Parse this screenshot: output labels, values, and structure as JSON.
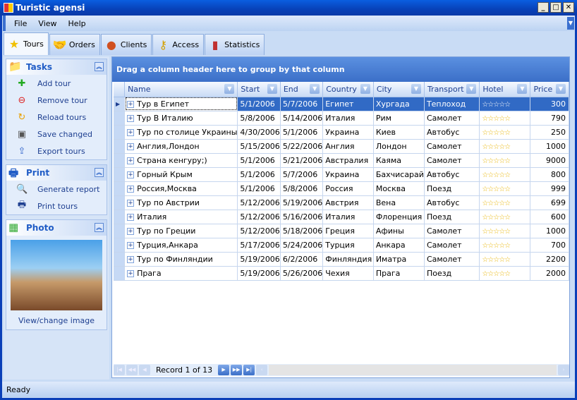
{
  "window": {
    "title": "Turistic agensi"
  },
  "menu": [
    "File",
    "View",
    "Help"
  ],
  "tabs": [
    {
      "label": "Tours",
      "icon": "star-icon"
    },
    {
      "label": "Orders",
      "icon": "handshake-icon"
    },
    {
      "label": "Clients",
      "icon": "person-icon"
    },
    {
      "label": "Access",
      "icon": "key-icon"
    },
    {
      "label": "Statistics",
      "icon": "chart-icon"
    }
  ],
  "tasks": {
    "title": "Tasks",
    "items": [
      {
        "label": "Add tour",
        "icon": "plus-icon"
      },
      {
        "label": "Remove tour",
        "icon": "minus-icon"
      },
      {
        "label": "Reload tours",
        "icon": "reload-icon"
      },
      {
        "label": "Save changed",
        "icon": "save-icon"
      },
      {
        "label": "Export tours",
        "icon": "export-icon"
      }
    ]
  },
  "print": {
    "title": "Print",
    "items": [
      {
        "label": "Generate report",
        "icon": "preview-icon"
      },
      {
        "label": "Print tours",
        "icon": "printer-icon"
      }
    ]
  },
  "photo": {
    "title": "Photo",
    "link": "View/change image"
  },
  "grid": {
    "group_hint": "Drag a column header here to group by that column",
    "columns": [
      "Name",
      "Start",
      "End",
      "Country",
      "City",
      "Transport",
      "Hotel",
      "Price"
    ],
    "rows": [
      [
        "Тур в Египет",
        "5/1/2006",
        "5/7/2006",
        "Египет",
        "Хургада",
        "Теплоход",
        5,
        "300"
      ],
      [
        "Тур В Италию",
        "5/8/2006",
        "5/14/2006",
        "Италия",
        "Рим",
        "Самолет",
        5,
        "790"
      ],
      [
        "Тур по столице Украины",
        "4/30/2006",
        "5/1/2006",
        "Украина",
        "Киев",
        "Автобус",
        5,
        "250"
      ],
      [
        "Англия,Лондон",
        "5/15/2006",
        "5/22/2006",
        "Англия",
        "Лондон",
        "Самолет",
        5,
        "1000"
      ],
      [
        "Страна кенгуру;)",
        "5/1/2006",
        "5/21/2006",
        "Австралия",
        "Каяма",
        "Самолет",
        5,
        "9000"
      ],
      [
        "Горный Крым",
        "5/1/2006",
        "5/7/2006",
        "Украина",
        "Бахчисарай",
        "Автобус",
        5,
        "800"
      ],
      [
        "Россия,Москва",
        "5/1/2006",
        "5/8/2006",
        "Россия",
        "Москва",
        "Поезд",
        5,
        "999"
      ],
      [
        "Тур по Австрии",
        "5/12/2006",
        "5/19/2006",
        "Австрия",
        "Вена",
        "Автобус",
        5,
        "699"
      ],
      [
        "Италия",
        "5/12/2006",
        "5/16/2006",
        "Италия",
        "Флоренция",
        "Поезд",
        5,
        "600"
      ],
      [
        "Тур по Греции",
        "5/12/2006",
        "5/18/2006",
        "Греция",
        "Афины",
        "Самолет",
        5,
        "1000"
      ],
      [
        "Турция,Анкара",
        "5/17/2006",
        "5/24/2006",
        "Турция",
        "Анкара",
        "Самолет",
        5,
        "700"
      ],
      [
        "Тур по Финляндии",
        "5/19/2006",
        "6/2/2006",
        "Финляндия",
        "Иматра",
        "Самолет",
        5,
        "2200"
      ],
      [
        "Прага",
        "5/19/2006",
        "5/26/2006",
        "Чехия",
        "Прага",
        "Поезд",
        5,
        "2000"
      ]
    ],
    "selected_row": 0,
    "record_text": "Record 1 of 13"
  },
  "status": "Ready"
}
